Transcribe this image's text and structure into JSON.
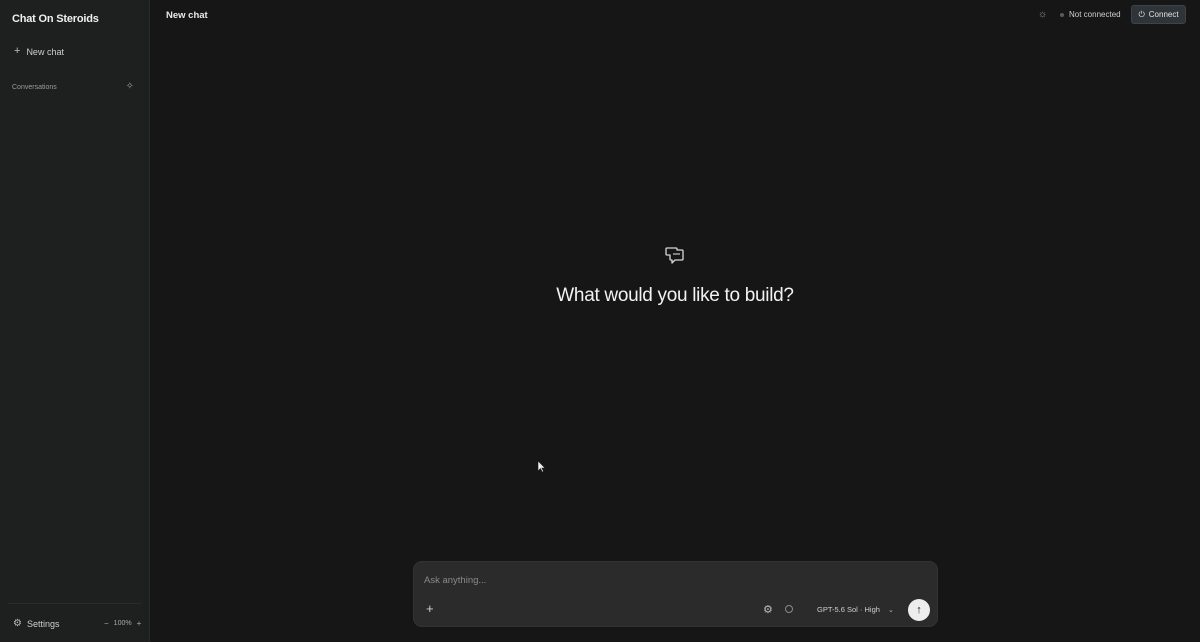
{
  "app": {
    "brand": "Chat On Steroids"
  },
  "sidebar": {
    "new_chat_label": "New chat",
    "conversations_label": "Conversations",
    "settings_label": "Settings",
    "zoom_level": "100%",
    "zoom_minus": "−",
    "zoom_plus": "+"
  },
  "topbar": {
    "title": "New chat",
    "status_text": "Not connected",
    "connect_label": "Connect"
  },
  "main": {
    "hero_title": "What would you like to build?"
  },
  "composer": {
    "placeholder": "Ask anything...",
    "model_label": "GPT-5.6 Sol · High"
  },
  "icons": {
    "plus": "plus-icon",
    "sparkle": "sparkle-icon",
    "gear": "gear-icon",
    "sun": "sun-icon",
    "power": "power-icon",
    "folder_chat": "chat-bubbles-icon",
    "send": "arrow-up-icon",
    "chevron": "chevron-down-icon"
  },
  "colors": {
    "background": "#161616",
    "sidebar": "#1e1f1f",
    "composer": "#2b2b2b",
    "connect_button": "#2f3438"
  }
}
